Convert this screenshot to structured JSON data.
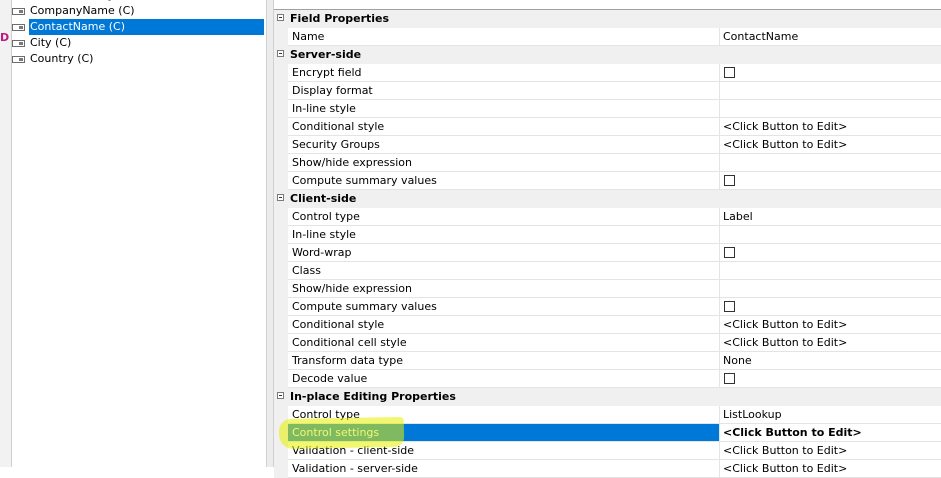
{
  "tree": {
    "left_marker": "D",
    "nodes": [
      {
        "label": "CompanyName (C)",
        "selected": false
      },
      {
        "label": "ContactName (C)",
        "selected": true
      },
      {
        "label": "City (C)",
        "selected": false
      },
      {
        "label": "Country (C)",
        "selected": false
      }
    ]
  },
  "grid": {
    "rows": [
      {
        "kind": "category",
        "label": "Field Properties"
      },
      {
        "kind": "prop",
        "name": "Name",
        "value": "ContactName"
      },
      {
        "kind": "category",
        "label": "Server-side"
      },
      {
        "kind": "prop",
        "name": "Encrypt field",
        "checkbox": true
      },
      {
        "kind": "prop",
        "name": "Display format",
        "value": ""
      },
      {
        "kind": "prop",
        "name": "In-line style",
        "value": ""
      },
      {
        "kind": "prop",
        "name": "Conditional style",
        "value": "<Click Button to Edit>"
      },
      {
        "kind": "prop",
        "name": "Security Groups",
        "value": "<Click Button to Edit>"
      },
      {
        "kind": "prop",
        "name": "Show/hide expression",
        "value": ""
      },
      {
        "kind": "prop",
        "name": "Compute summary values",
        "checkbox": true
      },
      {
        "kind": "category",
        "label": "Client-side"
      },
      {
        "kind": "prop",
        "name": "Control type",
        "value": "Label"
      },
      {
        "kind": "prop",
        "name": "In-line style",
        "value": ""
      },
      {
        "kind": "prop",
        "name": "Word-wrap",
        "checkbox": true
      },
      {
        "kind": "prop",
        "name": "Class",
        "value": ""
      },
      {
        "kind": "prop",
        "name": "Show/hide expression",
        "value": ""
      },
      {
        "kind": "prop",
        "name": "Compute summary values",
        "checkbox": true
      },
      {
        "kind": "prop",
        "name": "Conditional style",
        "value": "<Click Button to Edit>"
      },
      {
        "kind": "prop",
        "name": "Conditional cell style",
        "value": "<Click Button to Edit>"
      },
      {
        "kind": "prop",
        "name": "Transform data type",
        "value": "None"
      },
      {
        "kind": "prop",
        "name": "Decode value",
        "checkbox": true
      },
      {
        "kind": "category",
        "label": "In-place Editing Properties"
      },
      {
        "kind": "prop",
        "name": "Control type",
        "value": "ListLookup"
      },
      {
        "kind": "prop",
        "name": "Control settings",
        "value": "<Click Button to Edit>",
        "selected": true
      },
      {
        "kind": "prop",
        "name": "Validation - client-side",
        "value": "<Click Button to Edit>"
      },
      {
        "kind": "prop",
        "name": "Validation - server-side",
        "value": "<Click Button to Edit>"
      }
    ]
  },
  "colors": {
    "selection": "#0078d7",
    "highlighter": "#e8f000",
    "marker": "#c01880"
  }
}
